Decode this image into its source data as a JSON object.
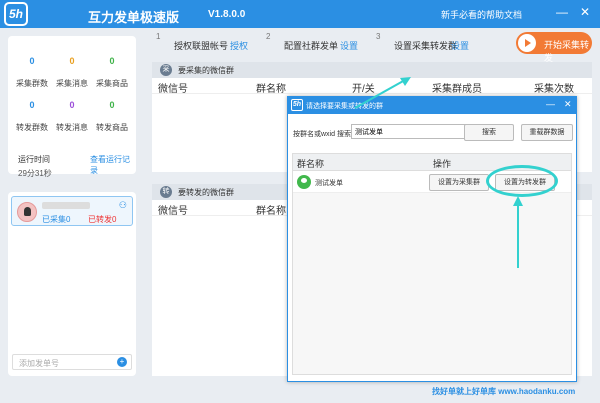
{
  "app": {
    "logo": "5h",
    "title": "互力发单极速版",
    "version": "V1.8.0.0",
    "help_link": "新手必看的帮助文档",
    "minimize": "—",
    "close": "✕"
  },
  "stats": [
    {
      "value": "0",
      "label": "采集群数",
      "color": "#2b8fe3"
    },
    {
      "value": "0",
      "label": "采集消息",
      "color": "#e9a020"
    },
    {
      "value": "0",
      "label": "采集商品",
      "color": "#3fb349"
    },
    {
      "value": "0",
      "label": "转发群数",
      "color": "#2b8fe3"
    },
    {
      "value": "0",
      "label": "转发消息",
      "color": "#9c4fd9"
    },
    {
      "value": "0",
      "label": "转发商品",
      "color": "#3fb349"
    }
  ],
  "runtime": {
    "label": "运行时间",
    "value": "29分31秒",
    "link": "查看运行记录"
  },
  "account": {
    "collected": "已采集0",
    "forwarded": "已转发0"
  },
  "add_account_placeholder": "添加发单号",
  "add_account_plus": "+",
  "steps": [
    {
      "num": "1",
      "text": "授权联盟帐号",
      "action": "授权"
    },
    {
      "num": "2",
      "text": "配置社群发单",
      "action": "设置"
    },
    {
      "num": "3",
      "text": "设置采集转发群",
      "action": "设置"
    }
  ],
  "start_button": "开始采集转发",
  "collect_section": {
    "icon": "采",
    "title": "要采集的微信群",
    "columns": [
      "微信号",
      "群名称",
      "开/关",
      "采集群成员",
      "采集次数"
    ]
  },
  "forward_section": {
    "icon": "转",
    "title": "要转发的微信群",
    "columns": [
      "微信号",
      "群名称"
    ]
  },
  "dialog": {
    "icon": "5h",
    "title": "请选择要采集或转发的群",
    "minimize": "—",
    "close": "✕",
    "search_label": "按群名或wxid 搜索:",
    "search_value": "测试发单",
    "search_button": "搜索",
    "reload_button": "重载群数据",
    "columns": [
      "群名称",
      "操作"
    ],
    "rows": [
      {
        "name": "测试发单",
        "btn_collect": "设置为采集群",
        "btn_forward": "设置为转发群"
      }
    ]
  },
  "watermark": "找好单就上好单库 www.haodanku.com"
}
